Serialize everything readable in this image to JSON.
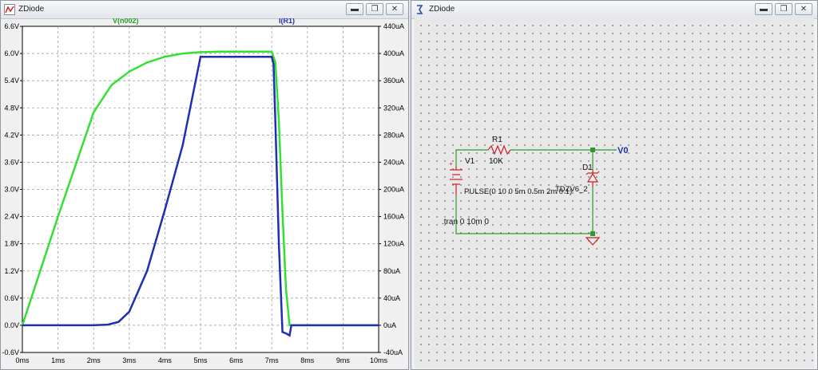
{
  "left_window": {
    "title": "ZDiode",
    "icon": "waveform-viewer-icon",
    "controls": {
      "minimize": "▬",
      "maximize": "❐",
      "close": "✕"
    }
  },
  "right_window": {
    "title": "ZDiode",
    "icon": "schematic-icon",
    "controls": {
      "minimize": "▬",
      "maximize": "❐",
      "close": "✕"
    }
  },
  "colors": {
    "voltage_trace": "#35e035",
    "current_trace": "#1f2fb5",
    "wire": "#2e9a2e",
    "component": "#cc2020",
    "net_label": "#1a2ea8",
    "plot_bg": "#ffffff",
    "grid": "#a0a0a0"
  },
  "chart_data": {
    "type": "line",
    "series": [
      {
        "name": "V(n002)",
        "axis": "left",
        "x": [
          "0ms",
          "0.5ms",
          "1ms",
          "1.5ms",
          "2ms",
          "2.5ms",
          "3ms",
          "3.5ms",
          "4ms",
          "4.5ms",
          "5ms",
          "5.5ms",
          "6ms",
          "6.5ms",
          "7ms",
          "7.1ms",
          "7.2ms",
          "7.3ms",
          "7.4ms",
          "7.5ms",
          "10ms"
        ],
        "y": [
          0.0,
          1.2,
          2.4,
          3.55,
          4.7,
          5.3,
          5.6,
          5.8,
          5.93,
          6.0,
          6.03,
          6.04,
          6.04,
          6.04,
          6.04,
          5.8,
          4.5,
          2.5,
          0.8,
          0.0,
          0.0
        ]
      },
      {
        "name": "I(R1)",
        "axis": "right",
        "x": [
          "0ms",
          "2ms",
          "2.4ms",
          "2.7ms",
          "3ms",
          "3.5ms",
          "4ms",
          "4.5ms",
          "5ms",
          "5.5ms",
          "6ms",
          "6.5ms",
          "7ms",
          "7.05ms",
          "7.1ms",
          "7.2ms",
          "7.3ms",
          "7.4ms",
          "7.5ms",
          "7.55ms",
          "10ms"
        ],
        "y": [
          0,
          0,
          1,
          5,
          20,
          80,
          170,
          265,
          395,
          395,
          395,
          395,
          395,
          385,
          300,
          120,
          -10,
          -12,
          -15,
          0,
          0
        ]
      }
    ],
    "xaxis": {
      "ticks": [
        "0ms",
        "1ms",
        "2ms",
        "3ms",
        "4ms",
        "5ms",
        "6ms",
        "7ms",
        "8ms",
        "9ms",
        "10ms"
      ],
      "range": [
        0,
        10
      ]
    },
    "yaxis_left": {
      "ticks": [
        "6.6V",
        "6.0V",
        "5.4V",
        "4.8V",
        "4.2V",
        "3.6V",
        "3.0V",
        "2.4V",
        "1.8V",
        "1.2V",
        "0.6V",
        "0.0V",
        "-0.6V"
      ],
      "range": [
        -0.6,
        6.6
      ]
    },
    "yaxis_right": {
      "ticks": [
        "440uA",
        "400uA",
        "360uA",
        "320uA",
        "280uA",
        "240uA",
        "200uA",
        "160uA",
        "120uA",
        "80uA",
        "40uA",
        "0uA",
        "-40uA"
      ],
      "range": [
        -40,
        440
      ]
    },
    "grid": true
  },
  "schematic": {
    "r1_name": "R1",
    "r1_value": "10K",
    "v1_name": "V1",
    "v1_source": "PULSE(0 10 0 5m 0.5m 2m 0 1)",
    "d1_name": "D1",
    "d1_model": "TDZV6_2",
    "net_label": "V0",
    "directive": ".tran 0 10m 0",
    "v1_plus": "+"
  }
}
